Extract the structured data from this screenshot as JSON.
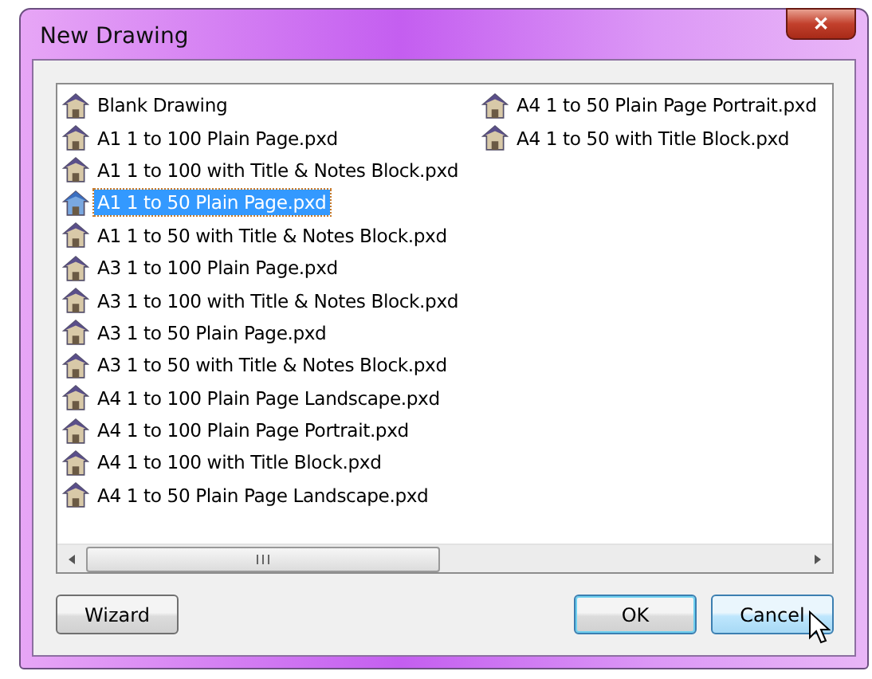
{
  "window": {
    "title": "New Drawing",
    "close": "✕"
  },
  "files": [
    {
      "label": "Blank Drawing",
      "selected": false
    },
    {
      "label": "A1 1 to 100 Plain Page.pxd",
      "selected": false
    },
    {
      "label": "A1 1 to 100 with Title & Notes Block.pxd",
      "selected": false
    },
    {
      "label": "A1 1 to 50 Plain Page.pxd",
      "selected": true
    },
    {
      "label": "A1 1 to 50 with Title & Notes Block.pxd",
      "selected": false
    },
    {
      "label": "A3 1 to 100 Plain Page.pxd",
      "selected": false
    },
    {
      "label": "A3 1 to 100 with Title & Notes Block.pxd",
      "selected": false
    },
    {
      "label": "A3 1 to 50 Plain Page.pxd",
      "selected": false
    },
    {
      "label": "A3 1 to 50 with Title & Notes Block.pxd",
      "selected": false
    },
    {
      "label": "A4 1 to 100 Plain Page Landscape.pxd",
      "selected": false
    },
    {
      "label": "A4 1 to 100 Plain Page Portrait.pxd",
      "selected": false
    },
    {
      "label": "A4 1 to 100 with Title Block.pxd",
      "selected": false
    },
    {
      "label": "A4 1 to 50 Plain Page Landscape.pxd",
      "selected": false
    },
    {
      "label": "A4 1 to 50 Plain Page Portrait.pxd",
      "selected": false
    },
    {
      "label": "A4 1 to 50 with Title Block.pxd",
      "selected": false
    }
  ],
  "buttons": [
    {
      "label": "Wizard",
      "kind": "normal"
    },
    {
      "label": "OK",
      "kind": "default"
    },
    {
      "label": "Cancel",
      "kind": "hover"
    }
  ]
}
